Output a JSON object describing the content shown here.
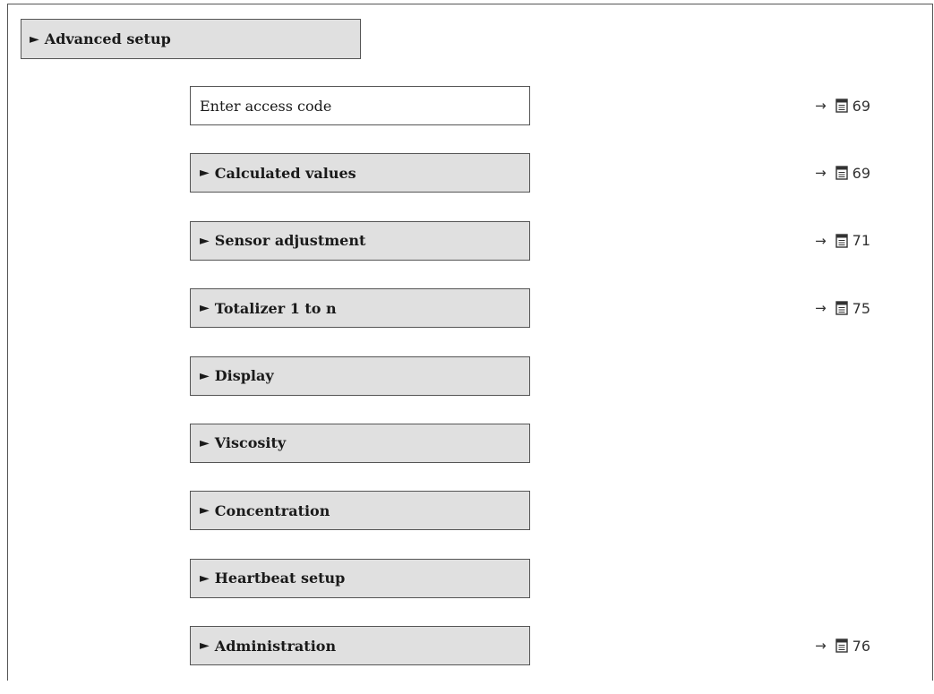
{
  "header": {
    "marker": "►",
    "label": "Advanced setup"
  },
  "items": [
    {
      "marker": "",
      "label": "Enter access code",
      "kind": "parameter",
      "ref": {
        "arrow": "→",
        "icon": "book-icon",
        "page": "69"
      }
    },
    {
      "marker": "►",
      "label": "Calculated values",
      "kind": "submenu",
      "ref": {
        "arrow": "→",
        "icon": "book-icon",
        "page": "69"
      }
    },
    {
      "marker": "►",
      "label": "Sensor adjustment",
      "kind": "submenu",
      "ref": {
        "arrow": "→",
        "icon": "book-icon",
        "page": "71"
      }
    },
    {
      "marker": "►",
      "label": "Totalizer 1 to n",
      "kind": "submenu",
      "ref": {
        "arrow": "→",
        "icon": "book-icon",
        "page": "75"
      }
    },
    {
      "marker": "►",
      "label": "Display",
      "kind": "submenu",
      "ref": null
    },
    {
      "marker": "►",
      "label": "Viscosity",
      "kind": "submenu",
      "ref": null
    },
    {
      "marker": "►",
      "label": "Concentration",
      "kind": "submenu",
      "ref": null
    },
    {
      "marker": "►",
      "label": "Heartbeat setup",
      "kind": "submenu",
      "ref": null
    },
    {
      "marker": "►",
      "label": "Administration",
      "kind": "submenu",
      "ref": {
        "arrow": "→",
        "icon": "book-icon",
        "page": "76"
      }
    }
  ],
  "colors": {
    "submenu_fill": "#e0e0e0",
    "parameter_fill": "#ffffff",
    "border": "#555555"
  }
}
